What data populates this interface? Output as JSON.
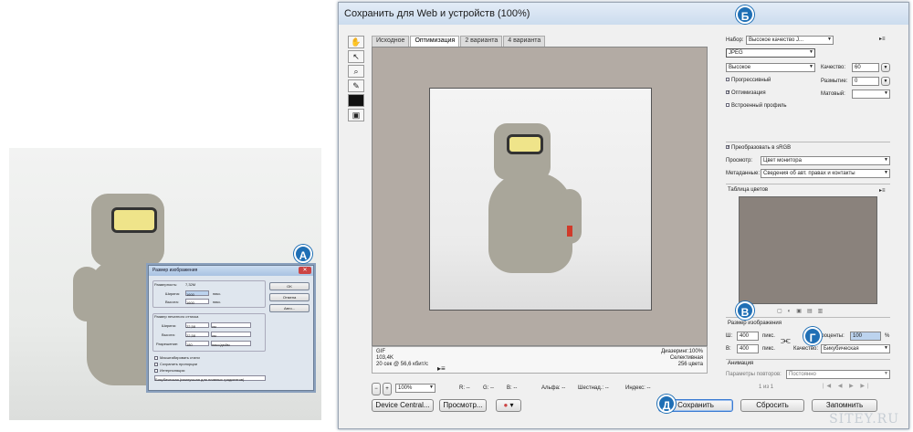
{
  "left_dialog": {
    "title": "Размер изображения",
    "dimensions_label": "Размерность:",
    "dimensions_value": "7,32M",
    "width_label": "Ширина:",
    "width_value": "1600",
    "width_unit": "пикс.",
    "height_label": "Высота:",
    "height_value": "1600",
    "height_unit": "пикс.",
    "print_group": "Размер печатного оттиска",
    "pw_label": "Ширина:",
    "pw_value": "22,58",
    "pw_unit": "см",
    "ph_label": "Высота:",
    "ph_value": "22,58",
    "ph_unit": "см",
    "res_label": "Разрешение:",
    "res_value": "180",
    "res_unit": "пикс/дюйм",
    "chk1": "Масштабировать стили",
    "chk2": "Сохранить пропорции",
    "chk3": "Интерполяция:",
    "interp": "Бикубическая (наилучшая для плавных градиентов)",
    "ok": "OK",
    "cancel": "Отмена",
    "auto": "Авто..."
  },
  "badges": {
    "a": "А",
    "b": "Б",
    "v": "В",
    "g": "Г",
    "d": "Д"
  },
  "window": {
    "title": "Сохранить для Web и устройств (100%)",
    "tabs": [
      "Исходное",
      "Оптимизация",
      "2 варианта",
      "4 варианта"
    ],
    "info_left": [
      "GIF",
      "103,4K",
      "20 сек @ 56,6 кбит/с"
    ],
    "info_right": [
      "Диазеринг:100%",
      "Селективная",
      "256 цвета"
    ],
    "zoom": "100%",
    "status": {
      "r": "R: --",
      "g": "G: --",
      "b": "B: --",
      "alpha": "Альфа: --",
      "hex": "Шестнад.: --",
      "index": "Индекс: --"
    },
    "buttons": {
      "device": "Device Central...",
      "preview": "Просмотр...",
      "save": "Сохранить",
      "reset": "Сбросить",
      "remember": "Запомнить"
    }
  },
  "panel": {
    "preset_label": "Набор:",
    "preset_value": "Высокое качество J...",
    "format": "JPEG",
    "quality_preset": "Высокое",
    "quality_label": "Качество:",
    "quality_value": "60",
    "progressive": "Прогрессивный",
    "blur_label": "Размытие:",
    "blur_value": "0",
    "optimized": "Оптимизация",
    "matte_label": "Матовый:",
    "icc": "Встроенный профиль",
    "srgb": "Преобразовать в sRGB",
    "preview_label": "Просмотр:",
    "preview_value": "Цвет монитора",
    "meta_label": "Метаданные:",
    "meta_value": "Сведения об авт. правах и контакты",
    "color_table": "Таблица цветов",
    "size_title": "Размер изображения",
    "w_label": "Ш:",
    "w_value": "400",
    "w_unit": "пикс.",
    "h_label": "В:",
    "h_value": "400",
    "h_unit": "пикс.",
    "percent_label": "Проценты:",
    "percent_value": "100",
    "percent_unit": "%",
    "quality2_label": "Качество:",
    "quality2_value": "Бикубическая",
    "anim_title": "Анимация",
    "loop_label": "Параметры повторов:",
    "loop_value": "Постоянно",
    "frame_counter": "1 из 1"
  },
  "watermark": "SITEY.RU"
}
